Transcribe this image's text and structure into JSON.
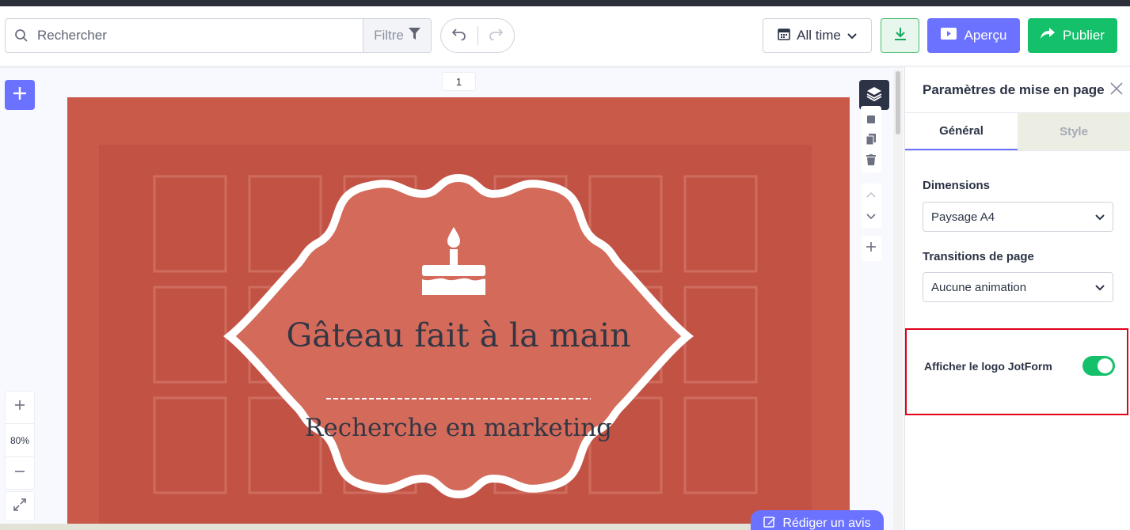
{
  "toolbar": {
    "search_placeholder": "Rechercher",
    "filter_label": "Filtre",
    "time_label": "All time",
    "preview_label": "Aperçu",
    "publish_label": "Publier"
  },
  "canvas": {
    "page_number": "1",
    "zoom_level": "80%",
    "slide_title": "Gâteau fait à la main",
    "slide_subtitle": "Recherche en marketing",
    "review_label": "Rédiger un avis"
  },
  "panel": {
    "title": "Paramètres de mise en page",
    "tabs": [
      {
        "label": "Général"
      },
      {
        "label": "Style"
      }
    ],
    "dimensions_label": "Dimensions",
    "dimensions_value": "Paysage A4",
    "transitions_label": "Transitions de page",
    "transitions_value": "Aucune animation",
    "logo_label": "Afficher le logo JotForm",
    "logo_enabled": true
  },
  "colors": {
    "accent": "#6b72ff",
    "publish": "#15c06b",
    "slide_overlay": "#c75a4b",
    "highlight": "#e2001a"
  }
}
